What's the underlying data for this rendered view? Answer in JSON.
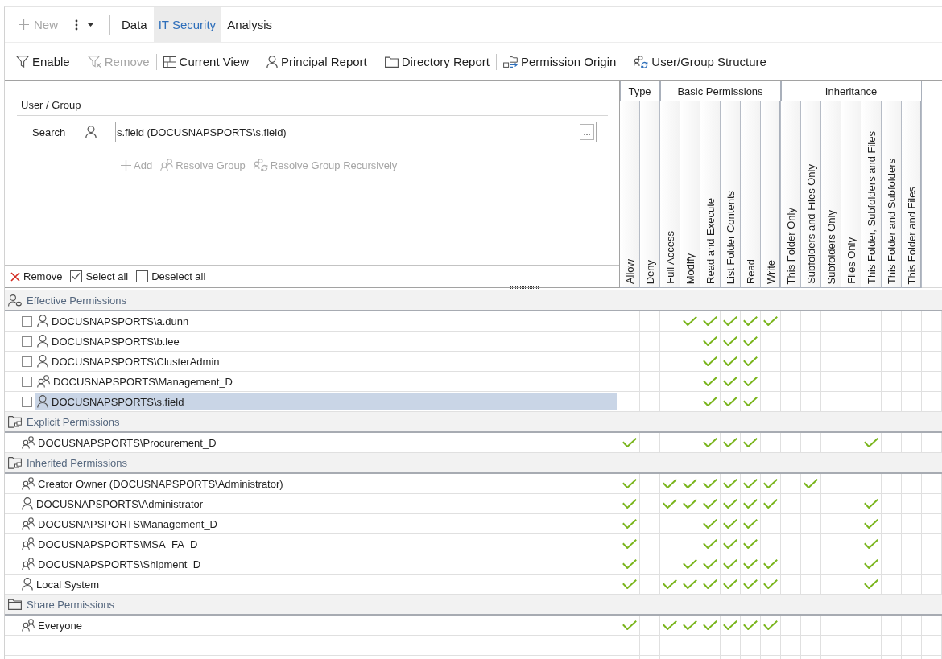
{
  "toolbar": {
    "new_button": {
      "label": "New",
      "disabled": true
    },
    "tabs": [
      {
        "label": "Data",
        "selected": false
      },
      {
        "label": "IT Security",
        "selected": true
      },
      {
        "label": "Analysis",
        "selected": false
      }
    ]
  },
  "ribbon": {
    "groups": [
      {
        "items": [
          {
            "label": "Enable",
            "disabled": false
          },
          {
            "label": "Remove",
            "disabled": true
          }
        ]
      },
      {
        "items": [
          {
            "label": "Current View",
            "disabled": false
          },
          {
            "label": "Principal Report",
            "disabled": false
          },
          {
            "label": "Directory Report",
            "disabled": false
          }
        ]
      },
      {
        "items": [
          {
            "label": "Permission Origin",
            "disabled": false
          },
          {
            "label": "User/Group Structure",
            "disabled": false
          }
        ]
      }
    ]
  },
  "user_group": {
    "title": "User / Group",
    "search_label": "Search",
    "search_value": "s.field (DOCUSNAPSPORTS\\s.field)",
    "browse_button": "...",
    "actions": [
      {
        "label": "Add",
        "disabled": true
      },
      {
        "label": "Resolve Group",
        "disabled": true
      },
      {
        "label": "Resolve Group Recursively",
        "disabled": true
      }
    ],
    "footer_actions": [
      "Remove",
      "Select all",
      "Deselect all"
    ]
  },
  "column_groups": [
    {
      "label": "Type",
      "columns": [
        "Allow",
        "Deny"
      ]
    },
    {
      "label": "Basic Permissions",
      "columns": [
        "Full Access",
        "Modify",
        "Read and Execute",
        "List Folder Contents",
        "Read",
        "Write"
      ]
    },
    {
      "label": "Inheritance",
      "columns": [
        "This Folder Only",
        "Subfolders and Files Only",
        "Subfolders Only",
        "Files Only",
        "This Folder, Subfolders and Files",
        "This Folder and Subfolders",
        "This Folder and Files"
      ]
    }
  ],
  "sections": [
    {
      "kind": "effective",
      "title": "Effective Permissions",
      "rows": [
        {
          "kind": "user",
          "name": "DOCUSNAPSPORTS\\a.dunn",
          "checked": false,
          "selected": false,
          "permissions": [
            false,
            false,
            false,
            true,
            true,
            true,
            true,
            true,
            false,
            false,
            false,
            false,
            false,
            false,
            false
          ]
        },
        {
          "kind": "user",
          "name": "DOCUSNAPSPORTS\\b.lee",
          "checked": false,
          "selected": false,
          "permissions": [
            false,
            false,
            false,
            false,
            true,
            true,
            true,
            false,
            false,
            false,
            false,
            false,
            false,
            false,
            false
          ]
        },
        {
          "kind": "user",
          "name": "DOCUSNAPSPORTS\\ClusterAdmin",
          "checked": false,
          "selected": false,
          "permissions": [
            false,
            false,
            false,
            false,
            true,
            true,
            true,
            false,
            false,
            false,
            false,
            false,
            false,
            false,
            false
          ]
        },
        {
          "kind": "group",
          "name": "DOCUSNAPSPORTS\\Management_D",
          "checked": false,
          "selected": false,
          "permissions": [
            false,
            false,
            false,
            false,
            true,
            true,
            true,
            false,
            false,
            false,
            false,
            false,
            false,
            false,
            false
          ]
        },
        {
          "kind": "user",
          "name": "DOCUSNAPSPORTS\\s.field",
          "checked": false,
          "selected": true,
          "permissions": [
            false,
            false,
            false,
            false,
            true,
            true,
            true,
            false,
            false,
            false,
            false,
            false,
            false,
            false,
            false
          ]
        }
      ]
    },
    {
      "kind": "explicit",
      "title": "Explicit Permissions",
      "rows": [
        {
          "kind": "group",
          "name": "DOCUSNAPSPORTS\\Procurement_D",
          "selected": false,
          "permissions": [
            true,
            false,
            false,
            false,
            true,
            true,
            true,
            false,
            false,
            false,
            false,
            false,
            true,
            false,
            false
          ]
        }
      ]
    },
    {
      "kind": "inherited",
      "title": "Inherited Permissions",
      "rows": [
        {
          "kind": "group",
          "name": "Creator Owner (DOCUSNAPSPORTS\\Administrator)",
          "selected": false,
          "permissions": [
            true,
            false,
            true,
            true,
            true,
            true,
            true,
            true,
            false,
            true,
            false,
            false,
            false,
            false,
            false
          ]
        },
        {
          "kind": "user",
          "name": "DOCUSNAPSPORTS\\Administrator",
          "selected": false,
          "permissions": [
            true,
            false,
            true,
            true,
            true,
            true,
            true,
            true,
            false,
            false,
            false,
            false,
            true,
            false,
            false
          ]
        },
        {
          "kind": "group",
          "name": "DOCUSNAPSPORTS\\Management_D",
          "selected": false,
          "permissions": [
            true,
            false,
            false,
            false,
            true,
            true,
            true,
            false,
            false,
            false,
            false,
            false,
            true,
            false,
            false
          ]
        },
        {
          "kind": "group",
          "name": "DOCUSNAPSPORTS\\MSA_FA_D",
          "selected": false,
          "permissions": [
            true,
            false,
            false,
            false,
            true,
            true,
            true,
            false,
            false,
            false,
            false,
            false,
            true,
            false,
            false
          ]
        },
        {
          "kind": "group",
          "name": "DOCUSNAPSPORTS\\Shipment_D",
          "selected": false,
          "permissions": [
            true,
            false,
            false,
            true,
            true,
            true,
            true,
            true,
            false,
            false,
            false,
            false,
            true,
            false,
            false
          ]
        },
        {
          "kind": "user",
          "name": "Local System",
          "selected": false,
          "permissions": [
            true,
            false,
            true,
            true,
            true,
            true,
            true,
            true,
            false,
            false,
            false,
            false,
            true,
            false,
            false
          ]
        }
      ]
    },
    {
      "kind": "share",
      "title": "Share Permissions",
      "rows": [
        {
          "kind": "group",
          "name": "Everyone",
          "selected": false,
          "permissions": [
            true,
            false,
            true,
            true,
            true,
            true,
            true,
            true,
            false,
            false,
            false,
            false,
            false,
            false,
            false
          ]
        }
      ]
    }
  ]
}
